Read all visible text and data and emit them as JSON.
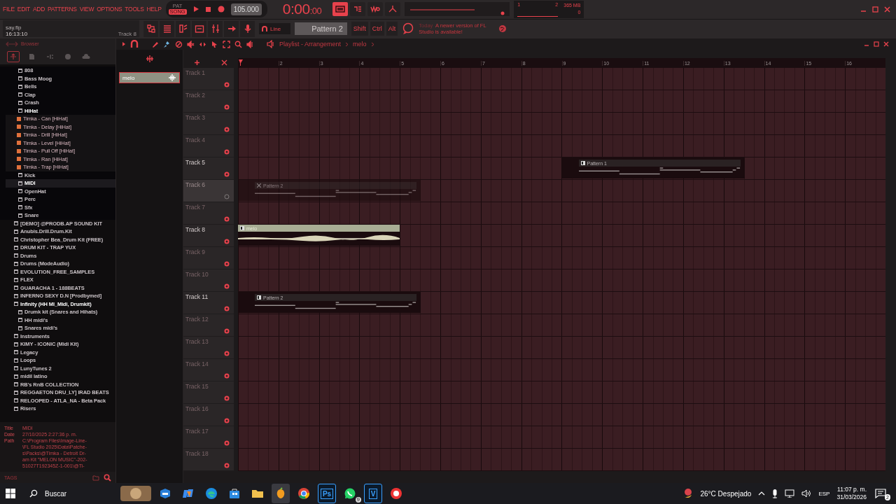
{
  "menu": [
    "FILE",
    "EDIT",
    "ADD",
    "PATTERNS",
    "VIEW",
    "OPTIONS",
    "TOOLS",
    "HELP"
  ],
  "transport": {
    "modes": [
      {
        "label": "PAT",
        "selected": false
      },
      {
        "label": "SONG",
        "selected": true
      }
    ],
    "tempo": "105.000",
    "time": "0:00",
    "time_fraction": ":00"
  },
  "toggles": [
    {
      "kind": "keyboard",
      "on": true
    },
    {
      "kind": "steps",
      "on": false
    },
    {
      "kind": "wait",
      "on": false
    },
    {
      "kind": "loop",
      "on": false
    }
  ],
  "cpu": {
    "core_a": "1",
    "core_b": "2",
    "memory": "365 MB",
    "polyphony": "0"
  },
  "project": {
    "file": "say.flp",
    "time": "16:13:10",
    "focus": "Track 8"
  },
  "snap": "Line",
  "pattern": "Pattern 2",
  "modifiers": [
    "Shift",
    "Ctrl",
    "Alt"
  ],
  "news": {
    "date": "Today",
    "text": "A newer version of FL Studio is available!"
  },
  "browser": {
    "title": "Browser",
    "tabs": [
      {
        "kind": "all",
        "selected": true
      },
      {
        "kind": "files",
        "selected": false
      },
      {
        "kind": "plugins",
        "selected": false
      },
      {
        "kind": "web",
        "selected": false
      },
      {
        "kind": "cloud",
        "selected": false
      }
    ],
    "nested_items": [
      {
        "label": "808",
        "kind": "folder",
        "selected": false
      },
      {
        "label": "Bass Moog",
        "kind": "folder",
        "selected": false
      },
      {
        "label": "Bells",
        "kind": "folder",
        "selected": false
      },
      {
        "label": "Clap",
        "kind": "folder",
        "selected": false
      },
      {
        "label": "Crash",
        "kind": "folder",
        "selected": false
      },
      {
        "label": "HiHat",
        "kind": "folder",
        "selected": false,
        "children": [
          {
            "label": "Timka - Can [HiHat]",
            "kind": "file",
            "selected": false
          },
          {
            "label": "Timka - Delay [HiHat]",
            "kind": "file",
            "selected": false
          },
          {
            "label": "Timka - Drill [HiHat]",
            "kind": "file",
            "selected": false
          },
          {
            "label": "Timka - Level [HiHat]",
            "kind": "file",
            "selected": false
          },
          {
            "label": "Timka - Pull Off [HiHat]",
            "kind": "file",
            "selected": false
          },
          {
            "label": "Timka - Ran [HiHat]",
            "kind": "file",
            "selected": false
          },
          {
            "label": "Timka - Trap [HiHat]",
            "kind": "file",
            "selected": false
          }
        ]
      },
      {
        "label": "Kick",
        "kind": "folder",
        "selected": false
      },
      {
        "label": "MIDI",
        "kind": "folder",
        "selected": true
      },
      {
        "label": "OpenHat",
        "kind": "folder",
        "selected": false
      },
      {
        "label": "Perc",
        "kind": "folder",
        "selected": false
      },
      {
        "label": "Sfx",
        "kind": "folder",
        "selected": false
      },
      {
        "label": "Snare",
        "kind": "folder",
        "selected": false
      }
    ],
    "items": [
      {
        "label": "[DEMO] @PRODB.AP SOUND KIT",
        "kind": "folder",
        "selected": false
      },
      {
        "label": "Anubis.Drill.Drum.Kit",
        "kind": "folder",
        "selected": false
      },
      {
        "label": "Christopher Bea_Drum Kit (FREE)",
        "kind": "folder",
        "selected": false
      },
      {
        "label": "DRUM KIT - TRAP YUX",
        "kind": "folder",
        "selected": false
      },
      {
        "label": "Drums",
        "kind": "folder",
        "selected": false
      },
      {
        "label": "Drums (ModeAudio)",
        "kind": "folder",
        "selected": false
      },
      {
        "label": "EVOLUTION_FREE_SAMPLES",
        "kind": "folder",
        "selected": false
      },
      {
        "label": "FLEX",
        "kind": "folder",
        "selected": false
      },
      {
        "label": "GUARACHA 1 - 188BEATS",
        "kind": "folder",
        "selected": false
      },
      {
        "label": "INFERNO SEXY D.N [Prodbymed]",
        "kind": "folder",
        "selected": false
      },
      {
        "label": "Infinity (HH Ml_Midi, Drumkit)",
        "kind": "folder",
        "selected": false,
        "children": [
          {
            "label": "Drumk kit (Snares and Hihats)",
            "kind": "folder",
            "selected": false
          },
          {
            "label": "HH midi's",
            "kind": "folder",
            "selected": false
          },
          {
            "label": "Snares midi's",
            "kind": "folder",
            "selected": false
          }
        ]
      },
      {
        "label": "Instruments",
        "kind": "folder",
        "selected": false
      },
      {
        "label": "KIMY - ICONIC (Midi Kit)",
        "kind": "folder",
        "selected": false
      },
      {
        "label": "Legacy",
        "kind": "folder",
        "selected": false
      },
      {
        "label": "Loops",
        "kind": "folder",
        "selected": false
      },
      {
        "label": "LunyTunes 2",
        "kind": "folder",
        "selected": false
      },
      {
        "label": "midil latino",
        "kind": "folder",
        "selected": false
      },
      {
        "label": "RB's RnB COLLECTION",
        "kind": "folder",
        "selected": false
      },
      {
        "label": "REGGAETON DRU_LY] IRAD BEATS",
        "kind": "folder",
        "selected": false
      },
      {
        "label": "RELOOPED - ATLA_NA - Beta Pack",
        "kind": "folder",
        "selected": false
      },
      {
        "label": "Risers",
        "kind": "folder",
        "selected": false
      }
    ],
    "info": {
      "title_label": "Title",
      "title": "MIDI",
      "date_label": "Date",
      "date": "27/10/2025 2:27:36 p. m.",
      "path_label": "Path",
      "path_lines": [
        "C:\\Program Files\\Image-Line-",
        "\\FL Studio 2025\\Data\\Patche-",
        "s\\Packs\\@Timka - Detroit Dr-",
        "am Kit \"MELON MUSIC\"-202-",
        "51027T192345Z-1-001\\@Ti-"
      ]
    },
    "tags": "TAGS"
  },
  "playlist": {
    "title": "Playlist - Arrangement",
    "crumb": "melo",
    "tools": [
      {
        "kind": "pencil",
        "selected": false
      },
      {
        "kind": "brush",
        "selected": true
      },
      {
        "kind": "delete",
        "selected": false
      },
      {
        "kind": "mute",
        "selected": false
      },
      {
        "kind": "slip",
        "selected": false
      },
      {
        "kind": "slice",
        "selected": false
      },
      {
        "kind": "select",
        "selected": false
      },
      {
        "kind": "zoom",
        "selected": false
      },
      {
        "kind": "play",
        "selected": false
      }
    ],
    "picker": [
      {
        "label": "melo",
        "selected": true
      }
    ],
    "ruler": [
      "2",
      "3",
      "4",
      "5",
      "6",
      "7",
      "8",
      "9",
      "10",
      "11",
      "12",
      "13",
      "14",
      "15",
      "16"
    ],
    "tracks": [
      {
        "name": "Track 1",
        "highlighted": false,
        "muted": false
      },
      {
        "name": "Track 2",
        "highlighted": false,
        "muted": false
      },
      {
        "name": "Track 3",
        "highlighted": false,
        "muted": false
      },
      {
        "name": "Track 4",
        "highlighted": false,
        "muted": false
      },
      {
        "name": "Track 5",
        "highlighted": true,
        "muted": false,
        "clips": [
          {
            "kind": "pattern",
            "label": "Pattern 1",
            "muted": false
          }
        ]
      },
      {
        "name": "Track 6",
        "highlighted": false,
        "muted": true,
        "clips": [
          {
            "kind": "pattern",
            "label": "Pattern 2",
            "muted": true
          }
        ]
      },
      {
        "name": "Track 7",
        "highlighted": false,
        "muted": false
      },
      {
        "name": "Track 8",
        "highlighted": true,
        "muted": false,
        "clips": [
          {
            "kind": "audio",
            "label": "melo",
            "muted": false
          }
        ]
      },
      {
        "name": "Track 9",
        "highlighted": false,
        "muted": false
      },
      {
        "name": "Track 10",
        "highlighted": false,
        "muted": false
      },
      {
        "name": "Track 11",
        "highlighted": true,
        "muted": false,
        "clips": [
          {
            "kind": "pattern",
            "label": "Pattern 2",
            "muted": false
          }
        ]
      },
      {
        "name": "Track 12",
        "highlighted": false,
        "muted": false
      },
      {
        "name": "Track 13",
        "highlighted": false,
        "muted": false
      },
      {
        "name": "Track 14",
        "highlighted": false,
        "muted": false
      },
      {
        "name": "Track 15",
        "highlighted": false,
        "muted": false
      },
      {
        "name": "Track 16",
        "highlighted": false,
        "muted": false
      },
      {
        "name": "Track 17",
        "highlighted": false,
        "muted": false
      },
      {
        "name": "Track 18",
        "highlighted": false,
        "muted": false
      }
    ]
  },
  "taskbar": {
    "search": "Buscar",
    "apps": [
      {
        "kind": "picture",
        "active": false
      },
      {
        "kind": "mail",
        "active": false
      },
      {
        "kind": "copilot",
        "active": false
      },
      {
        "kind": "edge",
        "active": false
      },
      {
        "kind": "store",
        "active": false
      },
      {
        "kind": "folder",
        "active": false
      },
      {
        "kind": "fruit",
        "active": true
      },
      {
        "kind": "chrome",
        "active": false
      },
      {
        "kind": "letters",
        "label": "Ps",
        "active": false
      },
      {
        "kind": "chat",
        "badge": "9",
        "active": false
      },
      {
        "kind": "letters",
        "label": "V",
        "active": false
      },
      {
        "kind": "record",
        "active": false
      }
    ],
    "weather": "26°C Despejado",
    "language": "ESP",
    "time": "11:07 p. m.",
    "date": "31/03/2026",
    "notifications": "2"
  }
}
